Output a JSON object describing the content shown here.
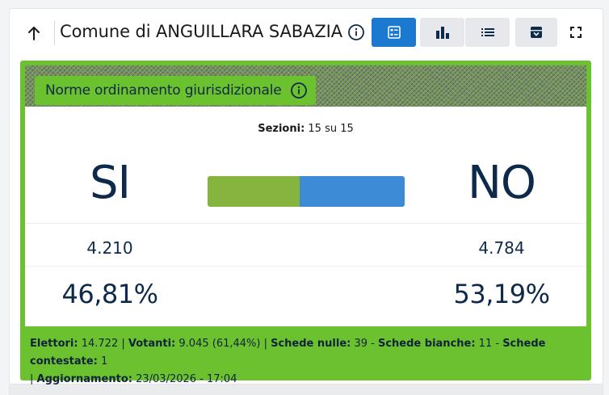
{
  "header": {
    "title": "Comune di ANGUILLARA SABAZIA",
    "icons": {
      "back": "arrow-up-icon",
      "info": "info-icon",
      "view_detail": "detail-view-icon",
      "view_chart": "bar-chart-icon",
      "view_list": "list-icon",
      "archive": "archive-icon",
      "fullscreen": "fullscreen-icon"
    },
    "active_view": "detail"
  },
  "question": {
    "label": "Norme ordinamento giurisdizionale",
    "info_icon": "info-icon"
  },
  "results": {
    "sezioni_label": "Sezioni:",
    "sezioni_value": " 15 su 15",
    "si_label": "SI",
    "no_label": "NO",
    "si_votes": "4.210",
    "no_votes": "4.784",
    "si_percent": "46,81%",
    "no_percent": "53,19%",
    "si_share": 46.81,
    "no_share": 53.19
  },
  "footer": {
    "elettori_label": "Elettori:",
    "elettori_value": " 14.722 | ",
    "votanti_label": "Votanti:",
    "votanti_value": " 9.045 (61,44%) | ",
    "nulle_label": "Schede nulle:",
    "nulle_value": " 39 - ",
    "bianche_label": "Schede bianche:",
    "bianche_value": " 11 - ",
    "contestate_label": "Schede contestate:",
    "contestate_value": " 1",
    "sep": "| ",
    "aggiornamento_label": "Aggiornamento:",
    "aggiornamento_value": " 23/03/2026 - 17:04"
  },
  "colors": {
    "accent_green": "#6cc12f",
    "si_bar": "#86b53f",
    "no_bar": "#3d8bd6",
    "active_button": "#1b7ad0",
    "text_dark": "#0e2a4a"
  }
}
